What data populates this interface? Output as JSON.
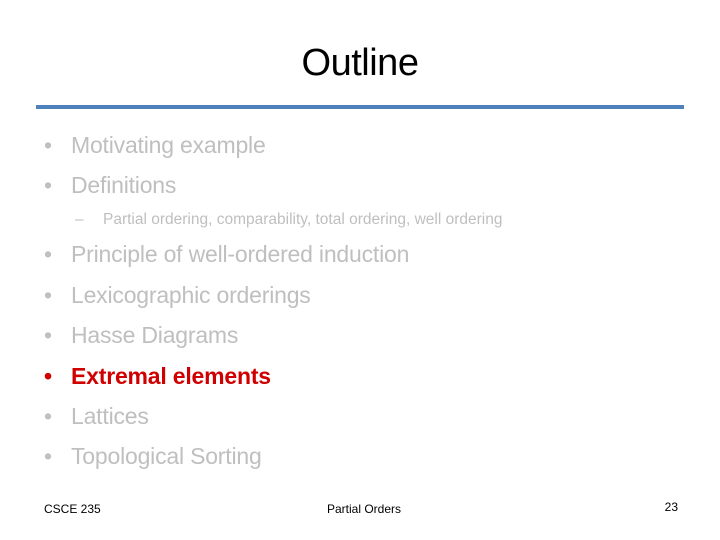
{
  "slide": {
    "title": "Outline",
    "accent_color": "#4f81bd",
    "highlight_color": "#d00000",
    "bullets": [
      {
        "label": "Motivating example",
        "active": false
      },
      {
        "label": "Definitions",
        "active": false,
        "sub": [
          "Partial ordering, comparability, total ordering, well ordering"
        ]
      },
      {
        "label": "Principle of well-ordered induction",
        "active": false
      },
      {
        "label": "Lexicographic orderings",
        "active": false
      },
      {
        "label": "Hasse Diagrams",
        "active": false
      },
      {
        "label": "Extremal elements",
        "active": true
      },
      {
        "label": "Lattices",
        "active": false
      },
      {
        "label": "Topological Sorting",
        "active": false
      }
    ],
    "bullet_glyph": "•",
    "sub_glyph": "–"
  },
  "footer": {
    "left": "CSCE 235",
    "center": "Partial Orders",
    "page_number": "23"
  }
}
